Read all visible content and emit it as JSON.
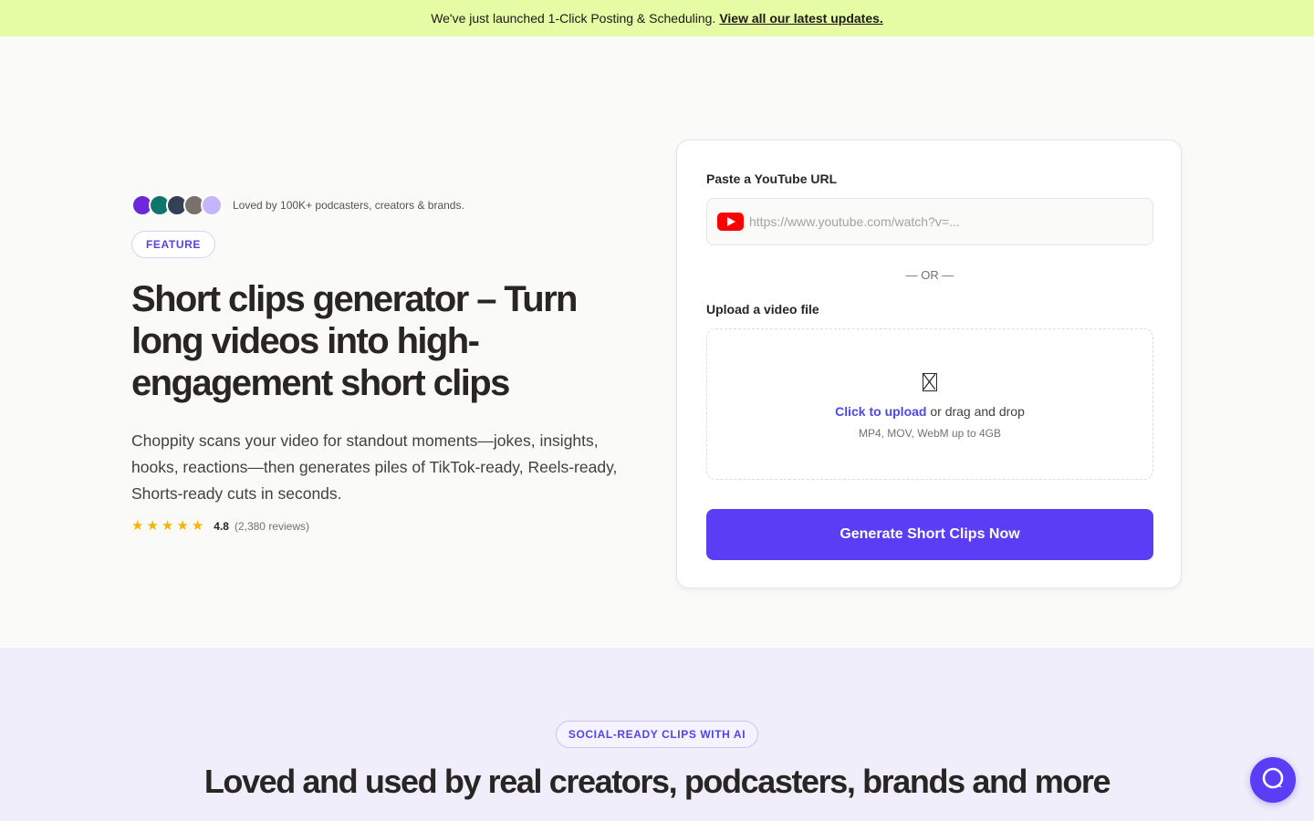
{
  "banner": {
    "text": "We've just launched 1-Click Posting & Scheduling.",
    "link": "View all our latest updates."
  },
  "hero": {
    "loved_text": "Loved by 100K+ podcasters, creators & brands.",
    "feature_badge": "FEATURE",
    "title": "Short clips generator – Turn long videos into high-engagement short clips",
    "description": "Choppity scans your video for standout moments—jokes, insights, hooks, reactions—then generates piles of TikTok-ready, Reels-ready, Shorts-ready cuts in seconds.",
    "rating_value": "4.8",
    "rating_count": "(2,380 reviews)",
    "star_color": "#f5b400"
  },
  "form": {
    "url_label": "Paste a YouTube URL",
    "url_placeholder": "https://www.youtube.com/watch?v=...",
    "or_text": "— OR —",
    "upload_label": "Upload a video file",
    "upload_link": "Click to upload",
    "upload_rest": " or drag and drop",
    "upload_hint": "MP4, MOV, WebM up to 4GB",
    "submit_label": "Generate Short Clips Now",
    "accent_color": "#5a3df5"
  },
  "section2": {
    "badge": "SOCIAL-READY CLIPS WITH AI",
    "title": "Loved and used by real creators, podcasters, brands and more"
  },
  "icons": {
    "youtube": "youtube-icon",
    "file": "file-icon",
    "star": "star-icon",
    "chat": "chat-icon"
  }
}
